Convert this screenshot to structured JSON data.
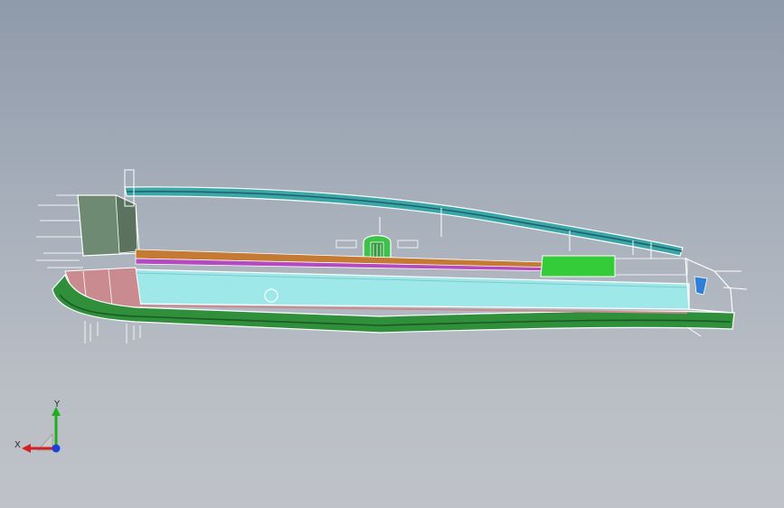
{
  "viewport": {
    "background_top": "#8f9aaa",
    "background_bottom": "#bfc3c8"
  },
  "model": {
    "icon": "cad-assembly-section",
    "colors": {
      "outline": "#ffffff",
      "rail": "#3aa6a6",
      "rail_dark": "#1f5f6b",
      "body_panel": "#9fe8ea",
      "base_shell": "#2f8f3a",
      "base_shell_dark": "#1c5a24",
      "block_grey": "#6f8a72",
      "knob": "#3fc24b",
      "green_block": "#35cc3a",
      "pink_part": "#c98a90",
      "magenta_part": "#b44ac0",
      "orange_part": "#c47a33",
      "blue_clip": "#2f7fd6"
    }
  },
  "axis_triad": {
    "x_label": "X",
    "y_label": "Y",
    "x_color": "#d32020",
    "y_color": "#1fae1f",
    "z_color": "#1f3fd6"
  }
}
